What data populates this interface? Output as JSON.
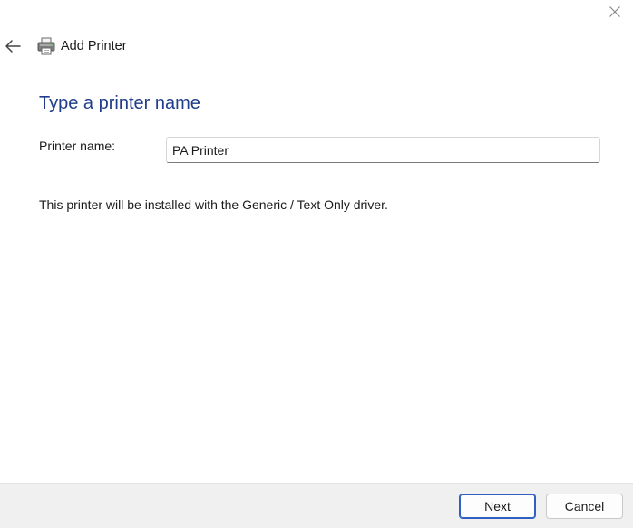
{
  "window": {
    "close_icon": "close-icon"
  },
  "header": {
    "back_icon": "back-arrow-icon",
    "app_icon": "printer-icon",
    "title": "Add Printer"
  },
  "main": {
    "page_title": "Type a printer name",
    "printer_name_label": "Printer name:",
    "printer_name_value": "PA Printer",
    "info_text": "This printer will be installed with the Generic / Text Only driver."
  },
  "footer": {
    "next_label": "Next",
    "cancel_label": "Cancel"
  },
  "colors": {
    "title_blue": "#1f3d8a",
    "accent_border": "#2f5fc2",
    "footer_bg": "#f0f0f0"
  }
}
